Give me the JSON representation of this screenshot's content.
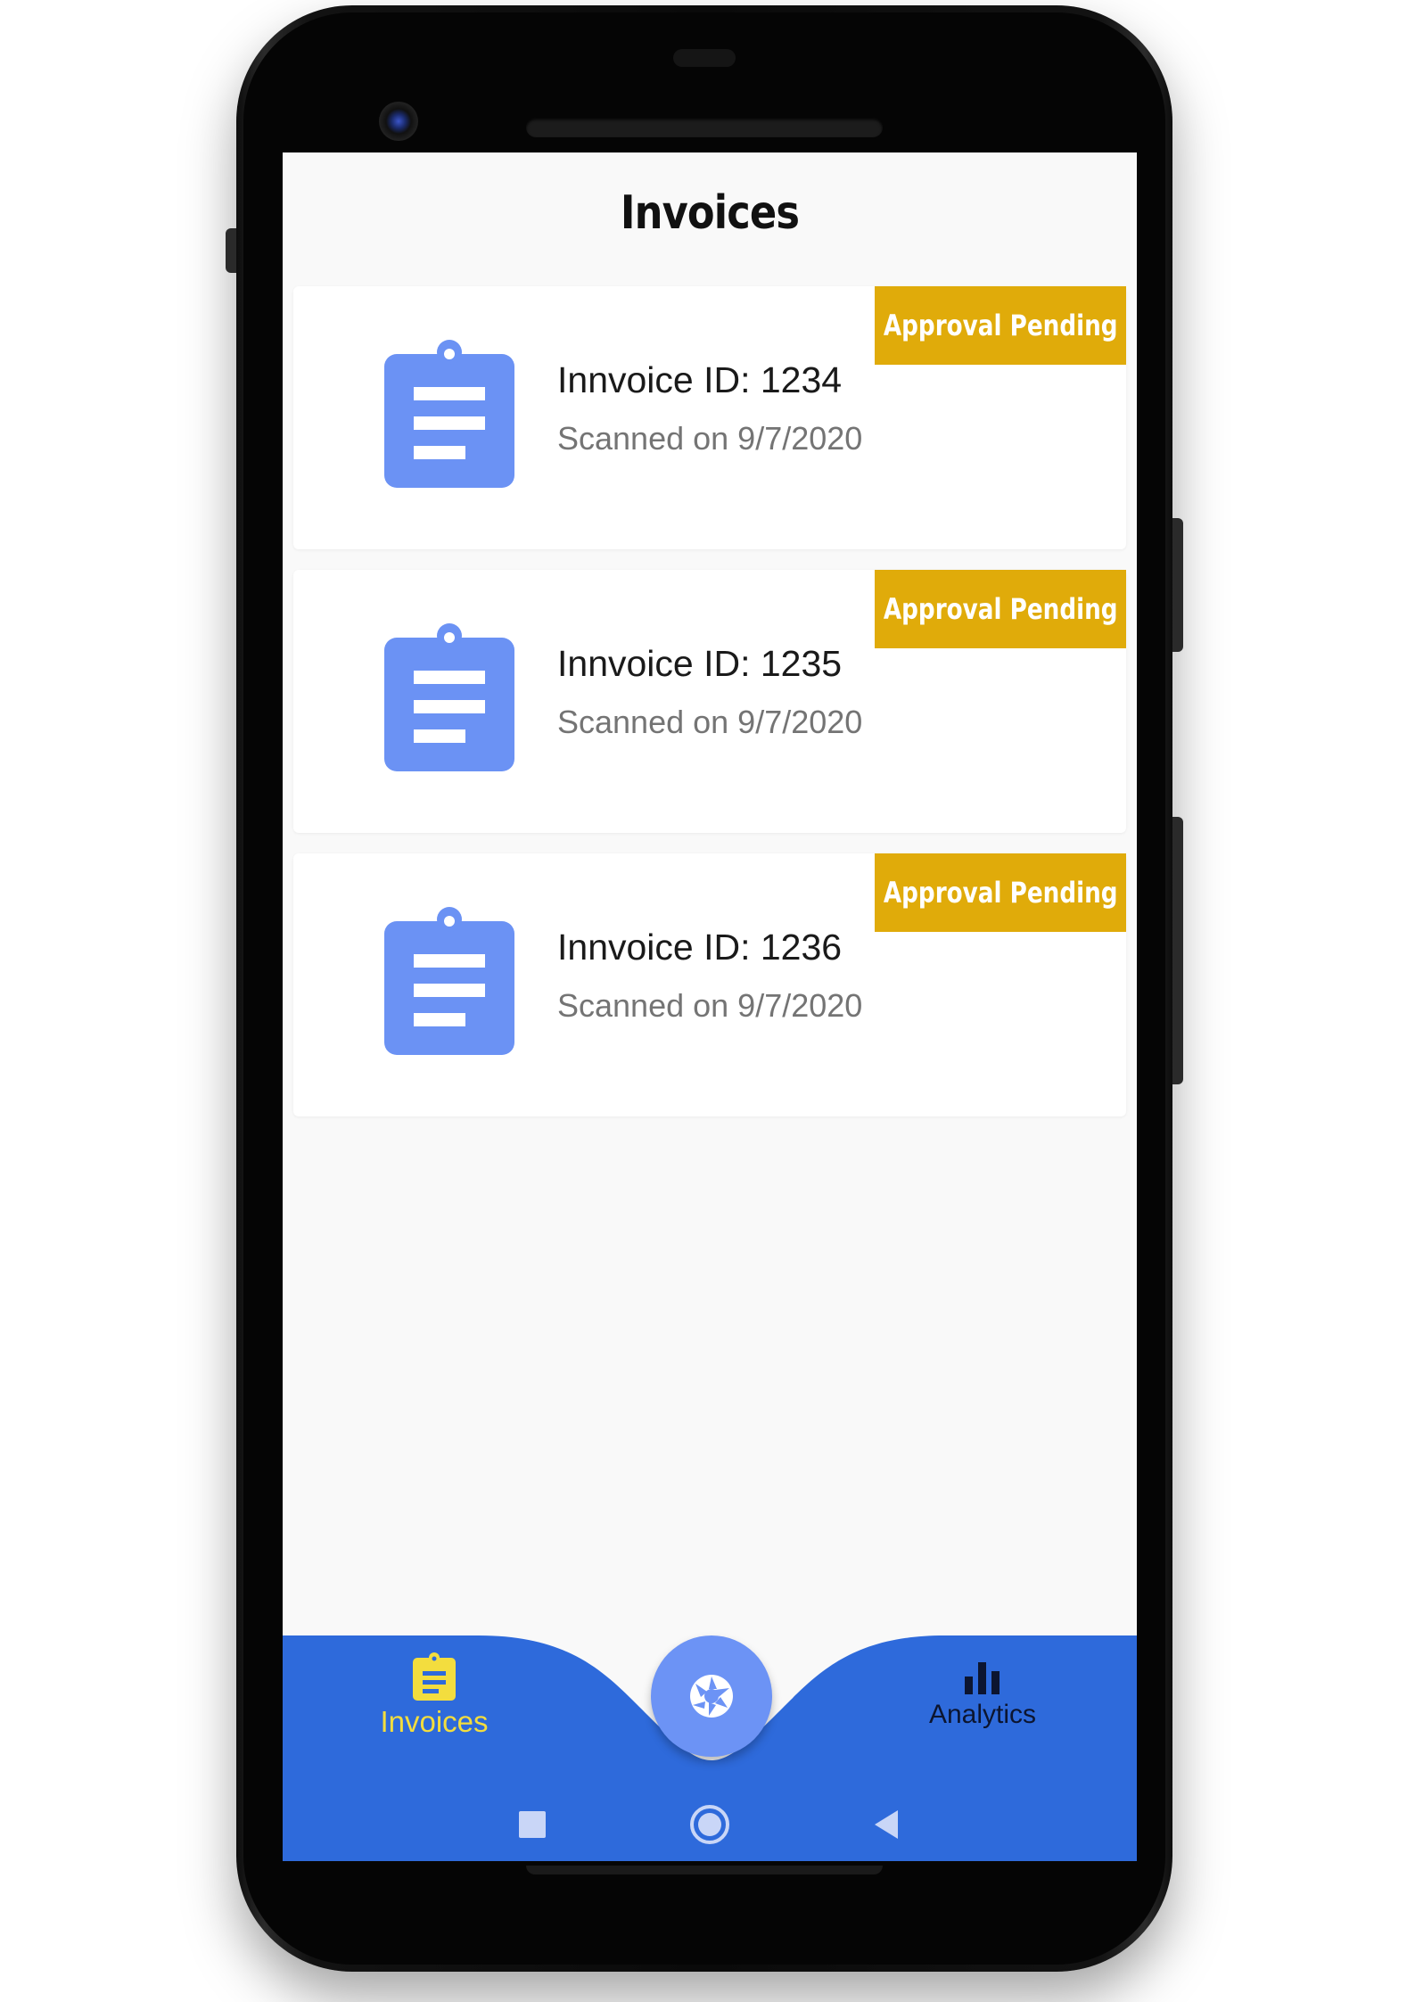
{
  "screen": {
    "title": "Invoices"
  },
  "invoices": [
    {
      "title": "Innvoice ID: 1234",
      "subtitle": "Scanned on 9/7/2020",
      "status": "Approval Pending"
    },
    {
      "title": "Innvoice ID: 1235",
      "subtitle": "Scanned on 9/7/2020",
      "status": "Approval Pending"
    },
    {
      "title": "Innvoice ID: 1236",
      "subtitle": "Scanned on 9/7/2020",
      "status": "Approval Pending"
    }
  ],
  "bottom_nav": {
    "left": {
      "label": "Invoices",
      "icon": "clipboard-icon",
      "active": true
    },
    "center": {
      "icon": "camera-shutter-icon"
    },
    "right": {
      "label": "Analytics",
      "icon": "bar-chart-icon",
      "active": false
    }
  },
  "system_nav": {
    "recents_icon": "square-icon",
    "home_icon": "circle-icon",
    "back_icon": "triangle-back-icon"
  },
  "colors": {
    "nav_background": "#2e6adb",
    "fab": "#6c93f5",
    "badge": "#e0ab0a",
    "invoice_icon": "#6b92f4",
    "active_nav": "#f3dd3e",
    "screen_background": "#f9f9f9"
  }
}
